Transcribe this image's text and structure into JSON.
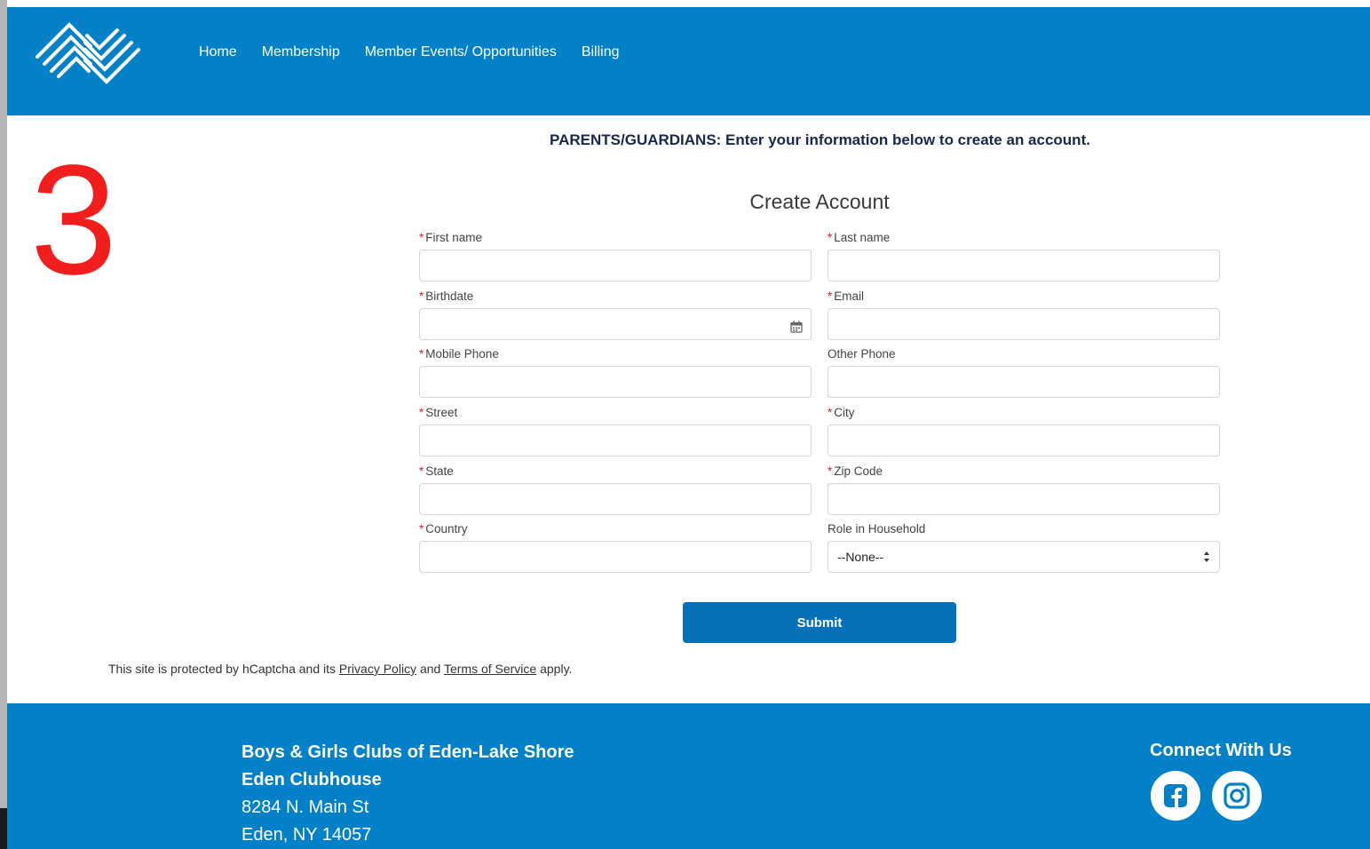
{
  "nav": {
    "items": [
      "Home",
      "Membership",
      "Member Events/ Opportunities",
      "Billing"
    ]
  },
  "overlay_number": "3",
  "intro_text": "PARENTS/GUARDIANS: Enter your information below to create an account.",
  "form": {
    "title": "Create Account",
    "required_marker": "*",
    "fields": {
      "first_name": "First name",
      "last_name": "Last name",
      "birthdate": "Birthdate",
      "email": "Email",
      "mobile_phone": "Mobile Phone",
      "other_phone": "Other Phone",
      "street": "Street",
      "city": "City",
      "state": "State",
      "zip": "Zip Code",
      "country": "Country",
      "role": "Role in Household"
    },
    "role_selected": "--None--",
    "submit_label": "Submit"
  },
  "captcha": {
    "prefix": "This site is protected by hCaptcha and its",
    "privacy": "Privacy Policy",
    "and": "and",
    "terms": "Terms of Service",
    "suffix": "apply."
  },
  "footer": {
    "org": "Boys & Girls Clubs of Eden-Lake Shore",
    "club": "Eden Clubhouse",
    "street": "8284 N. Main St",
    "city": "Eden, NY 14057",
    "connect": "Connect With Us"
  },
  "colors": {
    "brand_blue": "#0381c8",
    "button_blue": "#0670b8",
    "required_red": "#d0202a",
    "overlay_red": "#f21d1d"
  },
  "icons": [
    "logo-hands-icon",
    "calendar-icon",
    "select-arrows-icon",
    "facebook-icon",
    "instagram-icon"
  ]
}
